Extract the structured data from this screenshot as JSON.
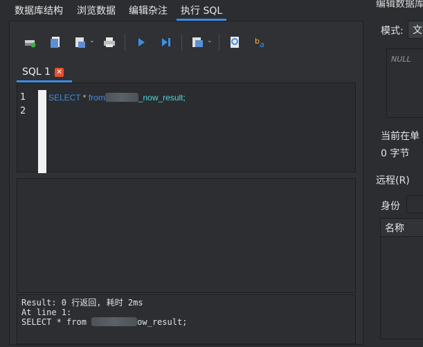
{
  "tabs": [
    {
      "label": "数据库结构"
    },
    {
      "label": "浏览数据"
    },
    {
      "label": "编辑杂注"
    },
    {
      "label": "执行 SQL"
    }
  ],
  "active_tab": 3,
  "toolbar": {
    "icons": [
      "open-tab-icon",
      "open-file-icon",
      "save-icon",
      "print-icon",
      "execute-icon",
      "execute-line-icon",
      "save-results-icon",
      "find-icon",
      "find-replace-icon"
    ]
  },
  "sql_tab": {
    "label": "SQL 1",
    "close": "✕"
  },
  "editor": {
    "line_numbers": [
      "1",
      "2"
    ],
    "code_keyword": "SELECT",
    "code_star": " * ",
    "code_from": "from",
    "code_table": "_now_result;"
  },
  "result": {
    "line1": "Result: 0 行返回, 耗时 2ms",
    "line2": "At line 1:",
    "line3_a": "SELECT * from ",
    "line3_b": "ow_result;"
  },
  "right_panel": {
    "title": "编辑数据库",
    "mode_label": "模式:",
    "mode_value": "文",
    "null_text": "NULL",
    "current_label": "当前在单",
    "bytes": "0 字节",
    "remote": "远程(R)",
    "identity": "身份",
    "name_header": "名称"
  },
  "colors": {
    "accent": "#3d8ee8",
    "keyword": "#3d8ee8",
    "table_name": "#4ddbdb",
    "close": "#e8502f"
  }
}
